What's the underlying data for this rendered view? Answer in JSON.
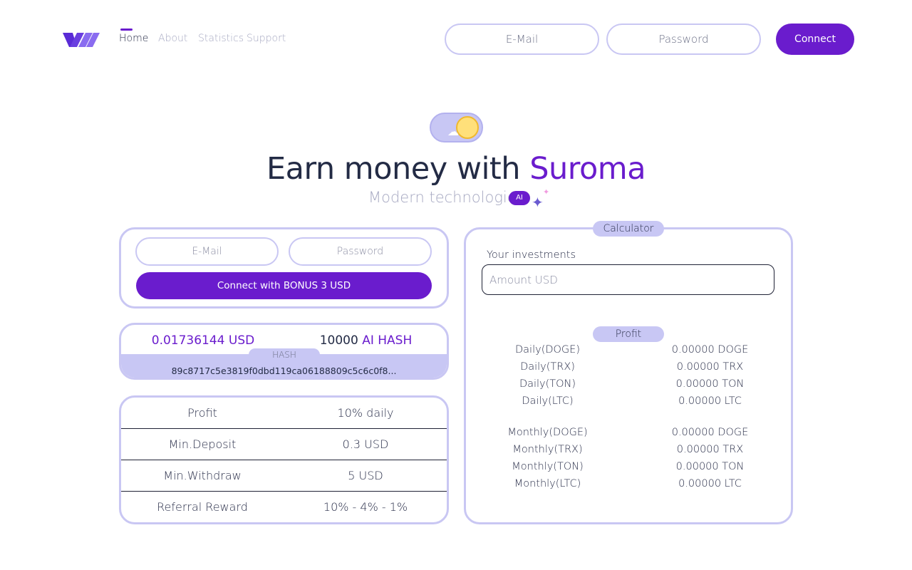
{
  "nav": {
    "links": [
      {
        "label": "Home",
        "active": true
      },
      {
        "label": "About",
        "active": false
      },
      {
        "label": "Statistics",
        "active": false
      },
      {
        "label": "Support",
        "active": false
      }
    ],
    "email_placeholder": "E-Mail",
    "password_placeholder": "Password",
    "connect_label": "Connect"
  },
  "hero": {
    "title_prefix": "Earn money with ",
    "brand": "Suroma",
    "subtitle": "Modern technologies",
    "badge": "AI"
  },
  "login": {
    "email_placeholder": "E-Mail",
    "password_placeholder": "Password",
    "bonus_label": "Connect with BONUS 3 USD"
  },
  "hash": {
    "usd_value": "0.01736144 USD",
    "ai_amount": "10000",
    "ai_unit": "AI HASH",
    "tab_label": "HASH",
    "hash_value": "89c8717c5e3819f0dbd119ca06188809c5c6c0f8..."
  },
  "info": {
    "rows": [
      {
        "label": "Profit",
        "value": "10% daily"
      },
      {
        "label": "Min.Deposit",
        "value": "0.3 USD"
      },
      {
        "label": "Min.Withdraw",
        "value": "5 USD"
      },
      {
        "label": "Referral Reward",
        "value": "10% - 4% - 1%"
      }
    ]
  },
  "calculator": {
    "title": "Calculator",
    "investments_label": "Your investments",
    "amount_placeholder": "Amount USD",
    "profit_title": "Profit",
    "daily": [
      {
        "label": "Daily(DOGE)",
        "value": "0.00000 DOGE"
      },
      {
        "label": "Daily(TRX)",
        "value": "0.00000 TRX"
      },
      {
        "label": "Daily(TON)",
        "value": "0.00000 TON"
      },
      {
        "label": "Daily(LTC)",
        "value": "0.00000 LTC"
      }
    ],
    "monthly": [
      {
        "label": "Monthly(DOGE)",
        "value": "0.00000 DOGE"
      },
      {
        "label": "Monthly(TRX)",
        "value": "0.00000 TRX"
      },
      {
        "label": "Monthly(TON)",
        "value": "0.00000 TON"
      },
      {
        "label": "Monthly(LTC)",
        "value": "0.00000 LTC"
      }
    ]
  },
  "colors": {
    "accent": "#6a1ccd",
    "border": "#c9c7f3",
    "light_fill": "#c8c7f4",
    "text_dark": "#232b45",
    "text_muted": "#a7a9c2"
  }
}
